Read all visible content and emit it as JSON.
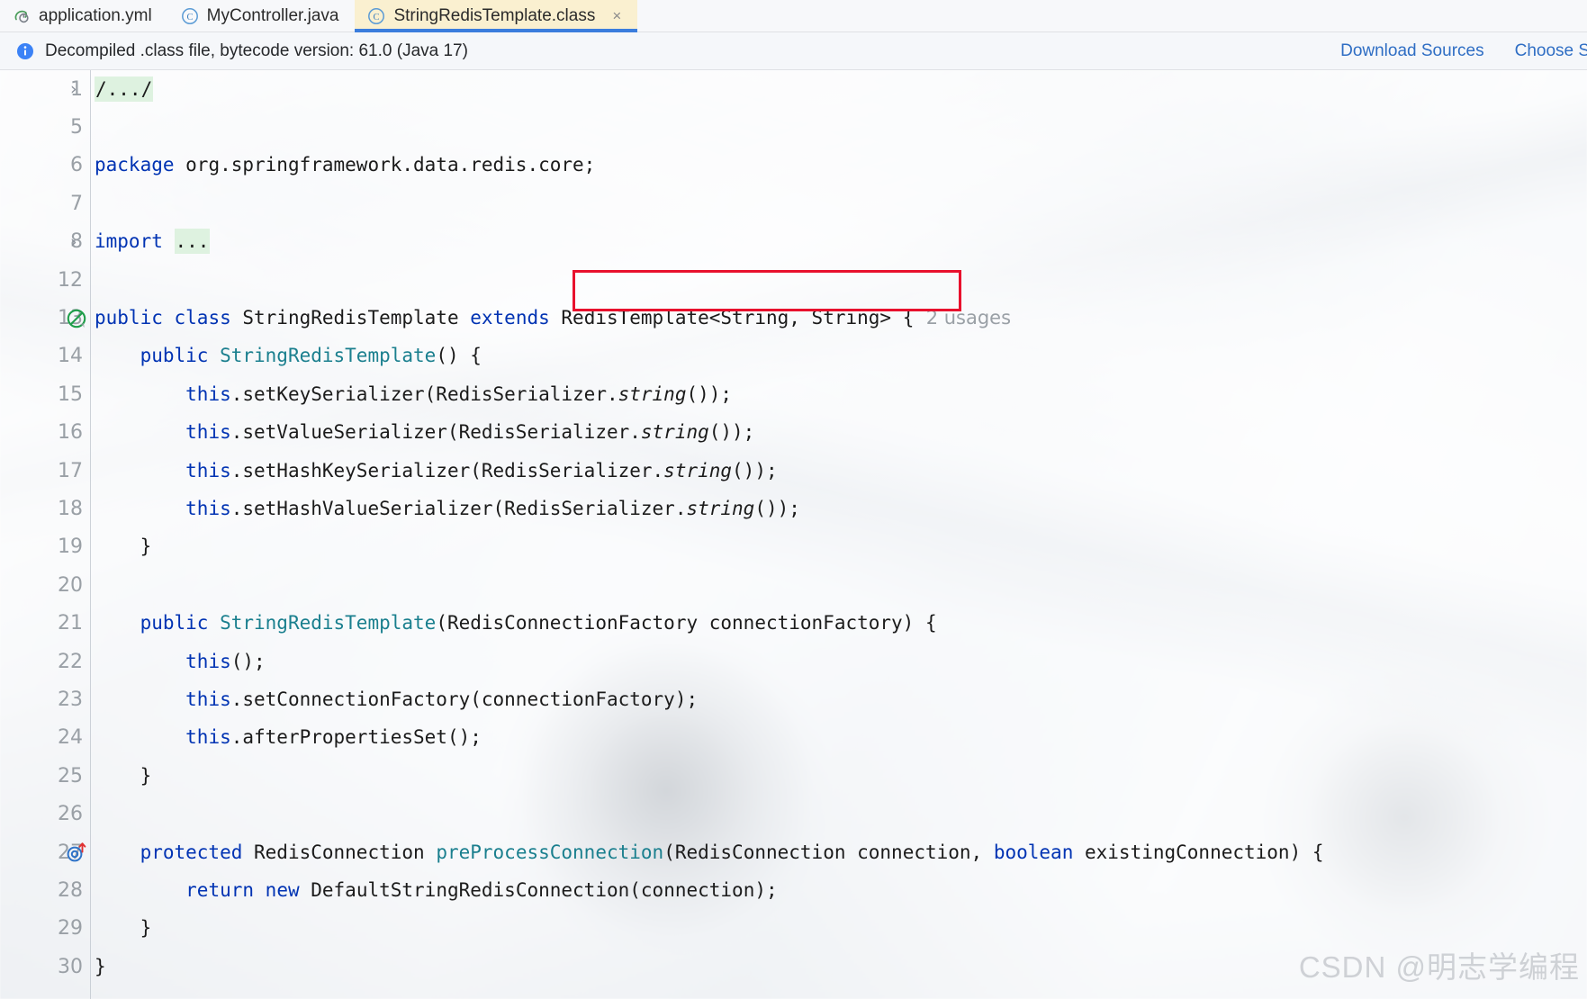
{
  "window": {
    "app": "IntelliJ IDEA editor",
    "watermark": "CSDN @明志学编程"
  },
  "tabs": [
    {
      "label": "application.yml",
      "icon": "spring-leaf-icon",
      "active": false,
      "closable": false
    },
    {
      "label": "MyController.java",
      "icon": "java-class-icon",
      "active": false,
      "closable": false
    },
    {
      "label": "StringRedisTemplate.class",
      "icon": "java-class-icon",
      "active": true,
      "closable": true,
      "close_glyph": "×"
    }
  ],
  "banner": {
    "icon": "info-icon",
    "text": "Decompiled .class file, bytecode version: 61.0 (Java 17)",
    "links": [
      {
        "label": "Download Sources"
      },
      {
        "label": "Choose Sourc"
      }
    ]
  },
  "annotation": {
    "red_box_color": "#e8112d",
    "highlights": "RedisTemplate<String, String> {"
  },
  "editor": {
    "usages_label": "2 usages",
    "lines": [
      {
        "num": "1",
        "fold": "›",
        "marker": "",
        "tokens": [
          {
            "t": "/.../",
            "c": "fold-hl"
          }
        ]
      },
      {
        "num": "5",
        "fold": "",
        "marker": "",
        "tokens": []
      },
      {
        "num": "6",
        "fold": "",
        "marker": "",
        "tokens": [
          {
            "t": "package",
            "c": "kw"
          },
          {
            "t": " org.springframework.data.redis.core;",
            "c": ""
          }
        ]
      },
      {
        "num": "7",
        "fold": "",
        "marker": "",
        "tokens": []
      },
      {
        "num": "8",
        "fold": "›",
        "marker": "",
        "tokens": [
          {
            "t": "import",
            "c": "kw"
          },
          {
            "t": " ",
            "c": ""
          },
          {
            "t": "...",
            "c": "fold-hl"
          }
        ]
      },
      {
        "num": "12",
        "fold": "",
        "marker": "",
        "tokens": []
      },
      {
        "num": "13",
        "fold": "",
        "marker": "no-entry-icon",
        "tokens": [
          {
            "t": "public",
            "c": "kw"
          },
          {
            "t": " ",
            "c": ""
          },
          {
            "t": "class",
            "c": "kw"
          },
          {
            "t": " StringRedisTemplate ",
            "c": ""
          },
          {
            "t": "extends",
            "c": "kw"
          },
          {
            "t": " RedisTemplate<String, String> {",
            "c": ""
          },
          {
            "t": "  2 usages",
            "c": "usages"
          }
        ]
      },
      {
        "num": "14",
        "fold": "",
        "marker": "",
        "tokens": [
          {
            "t": "    ",
            "c": ""
          },
          {
            "t": "public",
            "c": "kw"
          },
          {
            "t": " ",
            "c": ""
          },
          {
            "t": "StringRedisTemplate",
            "c": "fn"
          },
          {
            "t": "() {",
            "c": ""
          }
        ]
      },
      {
        "num": "15",
        "fold": "",
        "marker": "",
        "tokens": [
          {
            "t": "        ",
            "c": ""
          },
          {
            "t": "this",
            "c": "kw"
          },
          {
            "t": ".setKeySerializer(RedisSerializer.",
            "c": ""
          },
          {
            "t": "string",
            "c": "ital"
          },
          {
            "t": "());",
            "c": ""
          }
        ]
      },
      {
        "num": "16",
        "fold": "",
        "marker": "",
        "tokens": [
          {
            "t": "        ",
            "c": ""
          },
          {
            "t": "this",
            "c": "kw"
          },
          {
            "t": ".setValueSerializer(RedisSerializer.",
            "c": ""
          },
          {
            "t": "string",
            "c": "ital"
          },
          {
            "t": "());",
            "c": ""
          }
        ]
      },
      {
        "num": "17",
        "fold": "",
        "marker": "",
        "tokens": [
          {
            "t": "        ",
            "c": ""
          },
          {
            "t": "this",
            "c": "kw"
          },
          {
            "t": ".setHashKeySerializer(RedisSerializer.",
            "c": ""
          },
          {
            "t": "string",
            "c": "ital"
          },
          {
            "t": "());",
            "c": ""
          }
        ]
      },
      {
        "num": "18",
        "fold": "",
        "marker": "",
        "tokens": [
          {
            "t": "        ",
            "c": ""
          },
          {
            "t": "this",
            "c": "kw"
          },
          {
            "t": ".setHashValueSerializer(RedisSerializer.",
            "c": ""
          },
          {
            "t": "string",
            "c": "ital"
          },
          {
            "t": "());",
            "c": ""
          }
        ]
      },
      {
        "num": "19",
        "fold": "",
        "marker": "",
        "tokens": [
          {
            "t": "    }",
            "c": ""
          }
        ]
      },
      {
        "num": "20",
        "fold": "",
        "marker": "",
        "tokens": []
      },
      {
        "num": "21",
        "fold": "",
        "marker": "",
        "tokens": [
          {
            "t": "    ",
            "c": ""
          },
          {
            "t": "public",
            "c": "kw"
          },
          {
            "t": " ",
            "c": ""
          },
          {
            "t": "StringRedisTemplate",
            "c": "fn"
          },
          {
            "t": "(RedisConnectionFactory connectionFactory) {",
            "c": ""
          }
        ]
      },
      {
        "num": "22",
        "fold": "",
        "marker": "",
        "tokens": [
          {
            "t": "        ",
            "c": ""
          },
          {
            "t": "this",
            "c": "kw"
          },
          {
            "t": "();",
            "c": ""
          }
        ]
      },
      {
        "num": "23",
        "fold": "",
        "marker": "",
        "tokens": [
          {
            "t": "        ",
            "c": ""
          },
          {
            "t": "this",
            "c": "kw"
          },
          {
            "t": ".setConnectionFactory(connectionFactory);",
            "c": ""
          }
        ]
      },
      {
        "num": "24",
        "fold": "",
        "marker": "",
        "tokens": [
          {
            "t": "        ",
            "c": ""
          },
          {
            "t": "this",
            "c": "kw"
          },
          {
            "t": ".afterPropertiesSet();",
            "c": ""
          }
        ]
      },
      {
        "num": "25",
        "fold": "",
        "marker": "",
        "tokens": [
          {
            "t": "    }",
            "c": ""
          }
        ]
      },
      {
        "num": "26",
        "fold": "",
        "marker": "",
        "tokens": []
      },
      {
        "num": "27",
        "fold": "",
        "marker": "override-method-icon",
        "tokens": [
          {
            "t": "    ",
            "c": ""
          },
          {
            "t": "protected",
            "c": "kw"
          },
          {
            "t": " RedisConnection ",
            "c": ""
          },
          {
            "t": "preProcessConnection",
            "c": "fn"
          },
          {
            "t": "(RedisConnection connection, ",
            "c": ""
          },
          {
            "t": "boolean",
            "c": "kw"
          },
          {
            "t": " existingConnection) {",
            "c": ""
          }
        ]
      },
      {
        "num": "28",
        "fold": "",
        "marker": "",
        "tokens": [
          {
            "t": "        ",
            "c": ""
          },
          {
            "t": "return",
            "c": "kw"
          },
          {
            "t": " ",
            "c": ""
          },
          {
            "t": "new",
            "c": "kw"
          },
          {
            "t": " DefaultStringRedisConnection(connection);",
            "c": ""
          }
        ]
      },
      {
        "num": "29",
        "fold": "",
        "marker": "",
        "tokens": [
          {
            "t": "    }",
            "c": ""
          }
        ]
      },
      {
        "num": "30",
        "fold": "",
        "marker": "",
        "tokens": [
          {
            "t": "}",
            "c": ""
          }
        ]
      }
    ]
  }
}
